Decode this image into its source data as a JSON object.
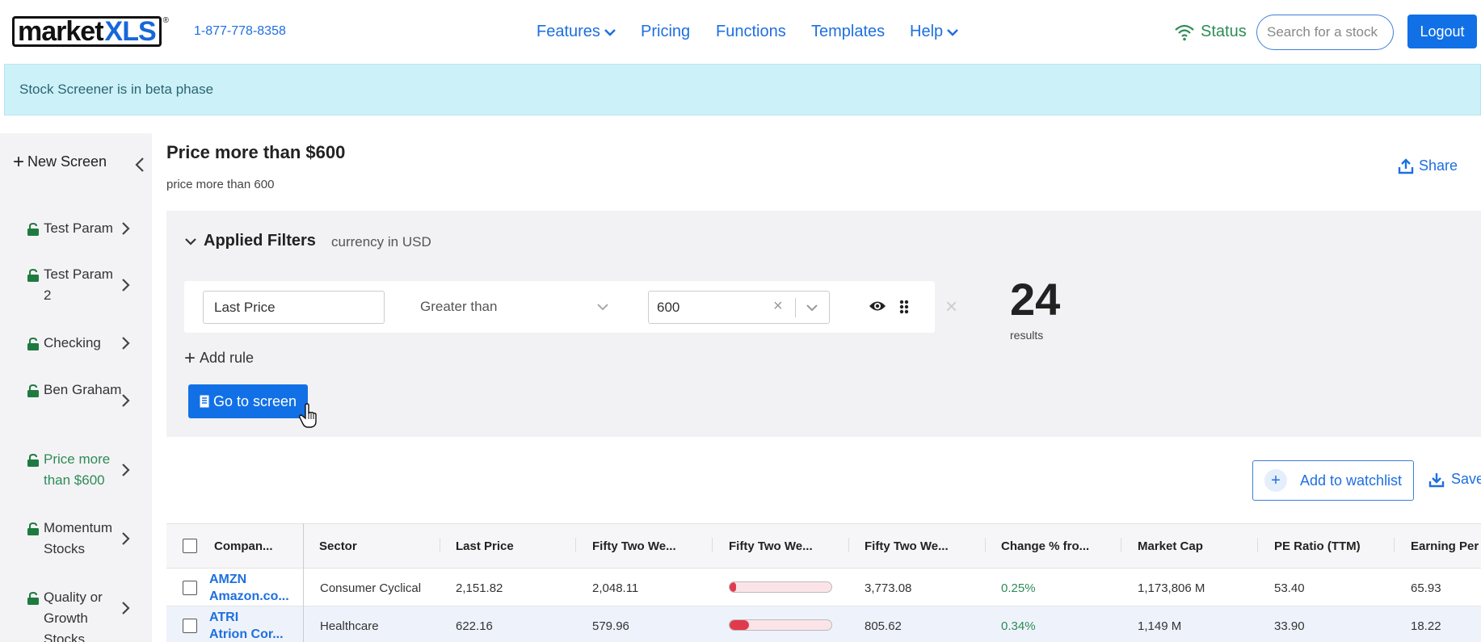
{
  "header": {
    "logo_left": "market",
    "logo_right": "XLS",
    "logo_mark": "®",
    "phone": "1-877-778-8358",
    "nav": [
      {
        "label": "Features",
        "dropdown": true
      },
      {
        "label": "Pricing",
        "dropdown": false
      },
      {
        "label": "Functions",
        "dropdown": false
      },
      {
        "label": "Templates",
        "dropdown": false
      },
      {
        "label": "Help",
        "dropdown": true
      }
    ],
    "status_label": "Status",
    "search_placeholder": "Search for a stock",
    "logout_label": "Logout"
  },
  "banner": {
    "text": "Stock Screener is in beta phase"
  },
  "sidebar": {
    "new_screen_label": "New Screen",
    "items": [
      {
        "label": "Test Param",
        "active": false
      },
      {
        "label": "Test Param 2",
        "active": false
      },
      {
        "label": "Checking",
        "active": false
      },
      {
        "label": "Ben Graham",
        "active": false
      },
      {
        "label": "Price more than $600",
        "active": true
      },
      {
        "label": "Momentum Stocks",
        "active": false
      },
      {
        "label": "Quality or Growth Stocks",
        "active": false
      }
    ]
  },
  "screen": {
    "title": "Price more than $600",
    "subtitle": "price more than 600",
    "share_label": "Share"
  },
  "filters": {
    "title": "Applied Filters",
    "currency": "currency in USD",
    "rule": {
      "field": "Last Price",
      "operator": "Greater than",
      "value": "600"
    },
    "results_count": "24",
    "results_label": "results",
    "add_rule_label": "Add rule",
    "go_to_screen_label": "Go to screen"
  },
  "actions": {
    "watchlist_label": "Add to watchlist",
    "save_label": "Save"
  },
  "table": {
    "columns": [
      "Compan...",
      "Sector",
      "Last Price",
      "Fifty Two We...",
      "Fifty Two We...",
      "Fifty Two We...",
      "Change % fro...",
      "Market Cap",
      "PE Ratio (TTM)",
      "Earning Per S"
    ],
    "rows": [
      {
        "ticker": "AMZN",
        "name": "Amazon.co...",
        "sector": "Consumer Cyclical",
        "last_price": "2,151.82",
        "low_52": "2,048.11",
        "range_position": 0.06,
        "high_52": "3,773.08",
        "change": "0.25%",
        "market_cap": "1,173,806 M",
        "pe": "53.40",
        "eps": "65.93"
      },
      {
        "ticker": "ATRI",
        "name": "Atrion Cor...",
        "sector": "Healthcare",
        "last_price": "622.16",
        "low_52": "579.96",
        "range_position": 0.19,
        "high_52": "805.62",
        "change": "0.34%",
        "market_cap": "1,149 M",
        "pe": "33.90",
        "eps": "18.22"
      }
    ]
  },
  "colors": {
    "accent": "#1170e6",
    "link": "#1e6fe0",
    "positive": "#2e8b57",
    "banner": "#cdf1f8",
    "range_fill": "#e03b4c"
  }
}
